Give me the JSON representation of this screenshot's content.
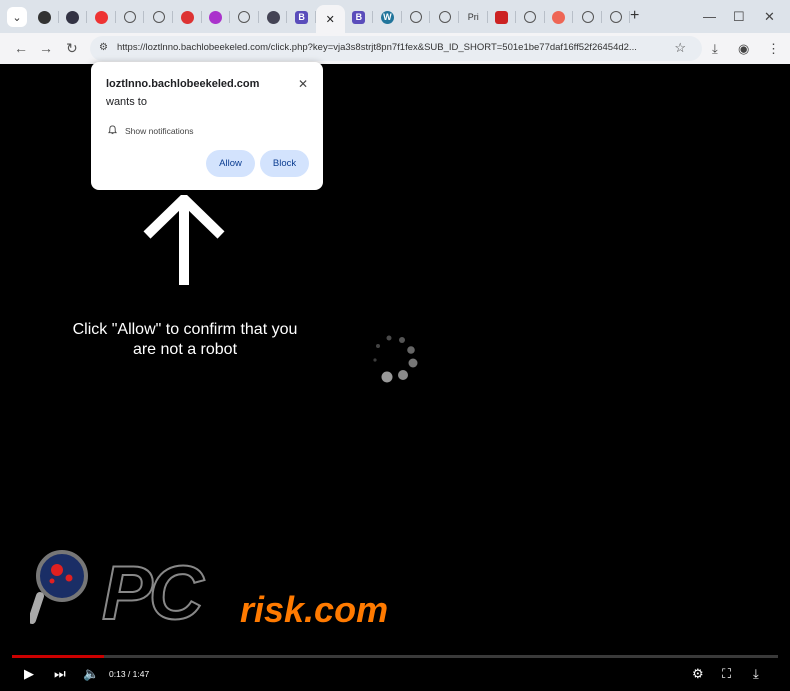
{
  "browser": {
    "tabs": [
      {
        "icon": "chat-favicon-icon",
        "active": false
      },
      {
        "icon": "radio-favicon-icon",
        "active": false
      },
      {
        "icon": "opera-favicon-icon",
        "active": false
      },
      {
        "icon": "globe-icon",
        "active": false
      },
      {
        "icon": "globe-icon",
        "active": false
      },
      {
        "icon": "red-circle-favicon-icon",
        "active": false
      },
      {
        "icon": "star-favicon-icon",
        "active": false
      },
      {
        "icon": "globe-icon",
        "active": false
      },
      {
        "icon": "bird-favicon-icon",
        "active": false
      },
      {
        "icon": "b-favicon-icon",
        "active": false
      },
      {
        "icon": "close-icon",
        "active": true
      },
      {
        "icon": "b-favicon-icon",
        "active": false
      },
      {
        "icon": "wordpress-favicon-icon",
        "active": false
      },
      {
        "icon": "globe-icon",
        "active": false
      },
      {
        "icon": "globe-icon",
        "active": false
      },
      {
        "icon": "text-favicon",
        "label": "Pri",
        "active": false
      },
      {
        "icon": "flag-favicon-icon",
        "active": false
      },
      {
        "icon": "globe-icon",
        "active": false
      },
      {
        "icon": "fox-favicon-icon",
        "active": false
      },
      {
        "icon": "globe-icon",
        "active": false
      },
      {
        "icon": "globe-icon",
        "active": false
      }
    ],
    "url": "https://loztlnno.bachlobeekeled.com/click.php?key=vja3s8strjt8pn7f1fex&SUB_ID_SHORT=501e1be77daf16ff52f26454d2..."
  },
  "popup": {
    "site": "loztlnno.bachlobeekeled.com",
    "wants": "wants to",
    "permission": "Show notifications",
    "allow": "Allow",
    "block": "Block"
  },
  "page": {
    "cta": "Click \"Allow\" to confirm that you are not a robot"
  },
  "logo": {
    "text_pc": "PC",
    "text_risk": "risk.com",
    "accent_color": "#ff7a00"
  },
  "player": {
    "time": "0:13 / 1:47",
    "progress": 0.12
  }
}
